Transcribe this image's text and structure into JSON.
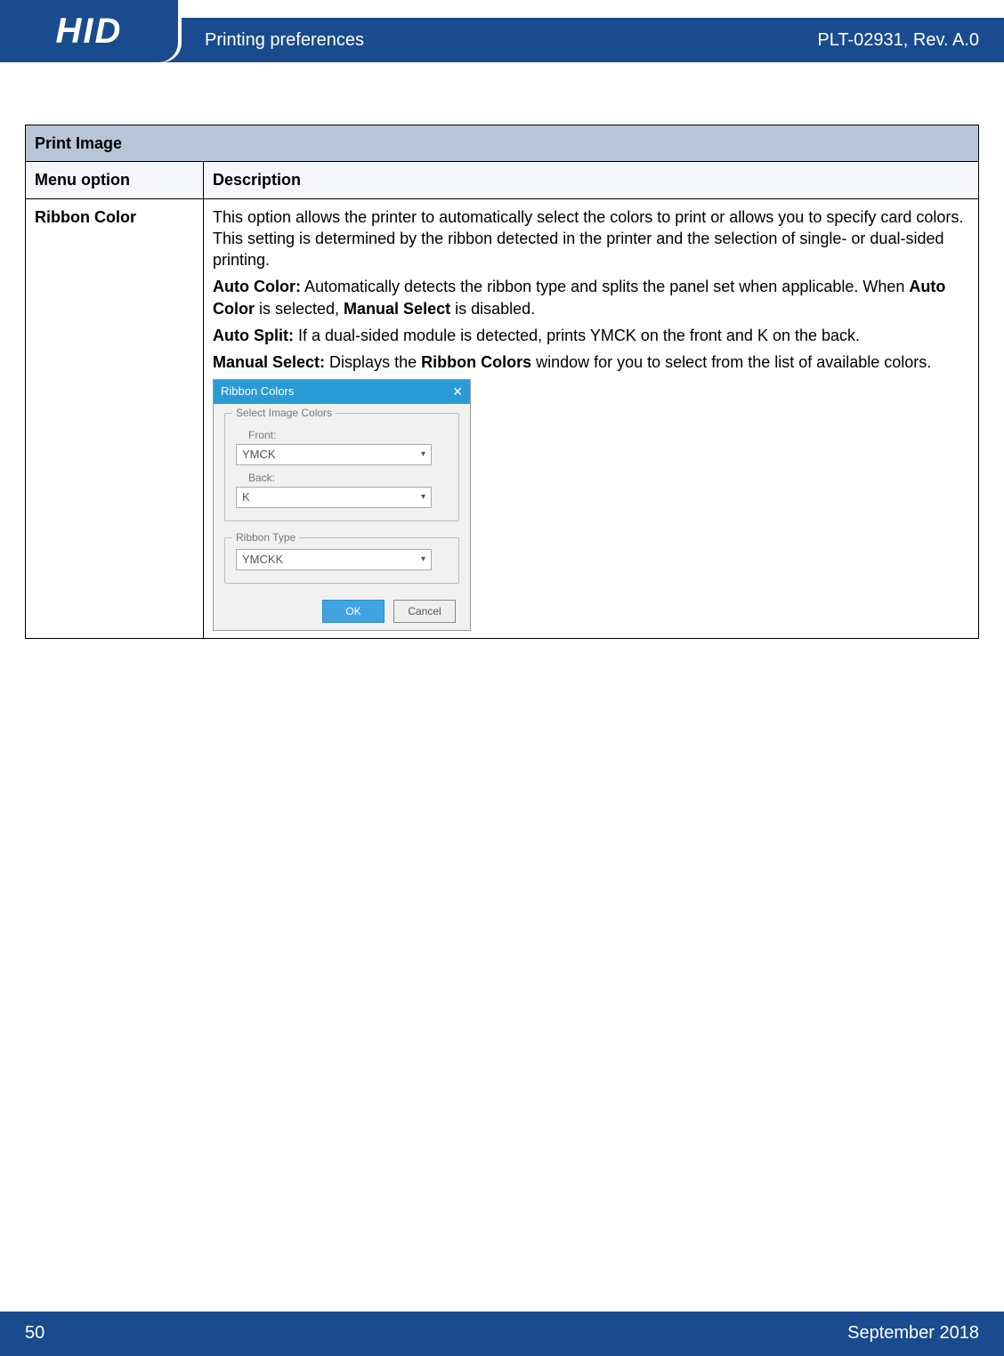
{
  "header": {
    "logo_text": "HID",
    "registered": "®",
    "title": "Printing preferences",
    "revision": "PLT-02931, Rev. A.0"
  },
  "footer": {
    "page_number": "50",
    "date": "September 2018"
  },
  "table": {
    "title": "Print Image",
    "col_menu": "Menu option",
    "col_desc": "Description",
    "row": {
      "menu": "Ribbon Color",
      "p1": "This option allows the printer to automatically select the colors to print or allows you to specify card colors. This setting is determined by the ribbon detected in the printer and the selection of single- or dual-sided printing.",
      "auto_color_label": "Auto Color:",
      "auto_color_text_a": " Automatically detects the ribbon type and splits the panel set when applicable. When ",
      "auto_color_bold1": "Auto Color",
      "auto_color_text_b": " is selected, ",
      "auto_color_bold2": "Manual Select",
      "auto_color_text_c": " is disabled.",
      "auto_split_label": "Auto Split:",
      "auto_split_text": " If a dual-sided module is detected, prints YMCK on the front and K on the back.",
      "manual_label": "Manual Select:",
      "manual_text_a": " Displays the ",
      "manual_bold": "Ribbon Colors",
      "manual_text_b": " window for you to select from the list of available colors."
    }
  },
  "dialog": {
    "title": "Ribbon Colors",
    "close": "✕",
    "group1": "Select Image Colors",
    "front_label": "Front:",
    "front_value": "YMCK",
    "back_label": "Back:",
    "back_value": "K",
    "group2": "Ribbon Type",
    "ribbon_type_value": "YMCKK",
    "ok": "OK",
    "cancel": "Cancel"
  }
}
